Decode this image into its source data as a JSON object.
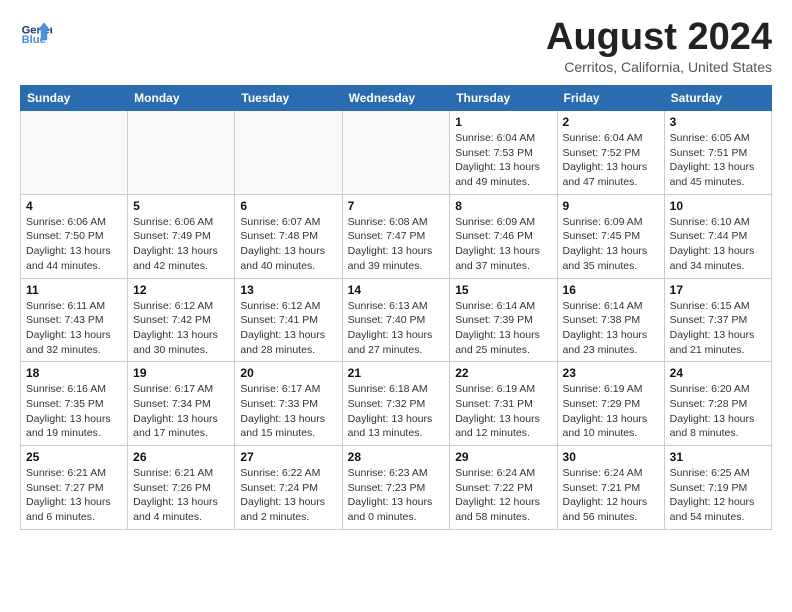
{
  "header": {
    "logo_line1": "General",
    "logo_line2": "Blue",
    "month_year": "August 2024",
    "location": "Cerritos, California, United States"
  },
  "weekdays": [
    "Sunday",
    "Monday",
    "Tuesday",
    "Wednesday",
    "Thursday",
    "Friday",
    "Saturday"
  ],
  "weeks": [
    [
      {
        "day": "",
        "info": ""
      },
      {
        "day": "",
        "info": ""
      },
      {
        "day": "",
        "info": ""
      },
      {
        "day": "",
        "info": ""
      },
      {
        "day": "1",
        "info": "Sunrise: 6:04 AM\nSunset: 7:53 PM\nDaylight: 13 hours\nand 49 minutes."
      },
      {
        "day": "2",
        "info": "Sunrise: 6:04 AM\nSunset: 7:52 PM\nDaylight: 13 hours\nand 47 minutes."
      },
      {
        "day": "3",
        "info": "Sunrise: 6:05 AM\nSunset: 7:51 PM\nDaylight: 13 hours\nand 45 minutes."
      }
    ],
    [
      {
        "day": "4",
        "info": "Sunrise: 6:06 AM\nSunset: 7:50 PM\nDaylight: 13 hours\nand 44 minutes."
      },
      {
        "day": "5",
        "info": "Sunrise: 6:06 AM\nSunset: 7:49 PM\nDaylight: 13 hours\nand 42 minutes."
      },
      {
        "day": "6",
        "info": "Sunrise: 6:07 AM\nSunset: 7:48 PM\nDaylight: 13 hours\nand 40 minutes."
      },
      {
        "day": "7",
        "info": "Sunrise: 6:08 AM\nSunset: 7:47 PM\nDaylight: 13 hours\nand 39 minutes."
      },
      {
        "day": "8",
        "info": "Sunrise: 6:09 AM\nSunset: 7:46 PM\nDaylight: 13 hours\nand 37 minutes."
      },
      {
        "day": "9",
        "info": "Sunrise: 6:09 AM\nSunset: 7:45 PM\nDaylight: 13 hours\nand 35 minutes."
      },
      {
        "day": "10",
        "info": "Sunrise: 6:10 AM\nSunset: 7:44 PM\nDaylight: 13 hours\nand 34 minutes."
      }
    ],
    [
      {
        "day": "11",
        "info": "Sunrise: 6:11 AM\nSunset: 7:43 PM\nDaylight: 13 hours\nand 32 minutes."
      },
      {
        "day": "12",
        "info": "Sunrise: 6:12 AM\nSunset: 7:42 PM\nDaylight: 13 hours\nand 30 minutes."
      },
      {
        "day": "13",
        "info": "Sunrise: 6:12 AM\nSunset: 7:41 PM\nDaylight: 13 hours\nand 28 minutes."
      },
      {
        "day": "14",
        "info": "Sunrise: 6:13 AM\nSunset: 7:40 PM\nDaylight: 13 hours\nand 27 minutes."
      },
      {
        "day": "15",
        "info": "Sunrise: 6:14 AM\nSunset: 7:39 PM\nDaylight: 13 hours\nand 25 minutes."
      },
      {
        "day": "16",
        "info": "Sunrise: 6:14 AM\nSunset: 7:38 PM\nDaylight: 13 hours\nand 23 minutes."
      },
      {
        "day": "17",
        "info": "Sunrise: 6:15 AM\nSunset: 7:37 PM\nDaylight: 13 hours\nand 21 minutes."
      }
    ],
    [
      {
        "day": "18",
        "info": "Sunrise: 6:16 AM\nSunset: 7:35 PM\nDaylight: 13 hours\nand 19 minutes."
      },
      {
        "day": "19",
        "info": "Sunrise: 6:17 AM\nSunset: 7:34 PM\nDaylight: 13 hours\nand 17 minutes."
      },
      {
        "day": "20",
        "info": "Sunrise: 6:17 AM\nSunset: 7:33 PM\nDaylight: 13 hours\nand 15 minutes."
      },
      {
        "day": "21",
        "info": "Sunrise: 6:18 AM\nSunset: 7:32 PM\nDaylight: 13 hours\nand 13 minutes."
      },
      {
        "day": "22",
        "info": "Sunrise: 6:19 AM\nSunset: 7:31 PM\nDaylight: 13 hours\nand 12 minutes."
      },
      {
        "day": "23",
        "info": "Sunrise: 6:19 AM\nSunset: 7:29 PM\nDaylight: 13 hours\nand 10 minutes."
      },
      {
        "day": "24",
        "info": "Sunrise: 6:20 AM\nSunset: 7:28 PM\nDaylight: 13 hours\nand 8 minutes."
      }
    ],
    [
      {
        "day": "25",
        "info": "Sunrise: 6:21 AM\nSunset: 7:27 PM\nDaylight: 13 hours\nand 6 minutes."
      },
      {
        "day": "26",
        "info": "Sunrise: 6:21 AM\nSunset: 7:26 PM\nDaylight: 13 hours\nand 4 minutes."
      },
      {
        "day": "27",
        "info": "Sunrise: 6:22 AM\nSunset: 7:24 PM\nDaylight: 13 hours\nand 2 minutes."
      },
      {
        "day": "28",
        "info": "Sunrise: 6:23 AM\nSunset: 7:23 PM\nDaylight: 13 hours\nand 0 minutes."
      },
      {
        "day": "29",
        "info": "Sunrise: 6:24 AM\nSunset: 7:22 PM\nDaylight: 12 hours\nand 58 minutes."
      },
      {
        "day": "30",
        "info": "Sunrise: 6:24 AM\nSunset: 7:21 PM\nDaylight: 12 hours\nand 56 minutes."
      },
      {
        "day": "31",
        "info": "Sunrise: 6:25 AM\nSunset: 7:19 PM\nDaylight: 12 hours\nand 54 minutes."
      }
    ]
  ]
}
